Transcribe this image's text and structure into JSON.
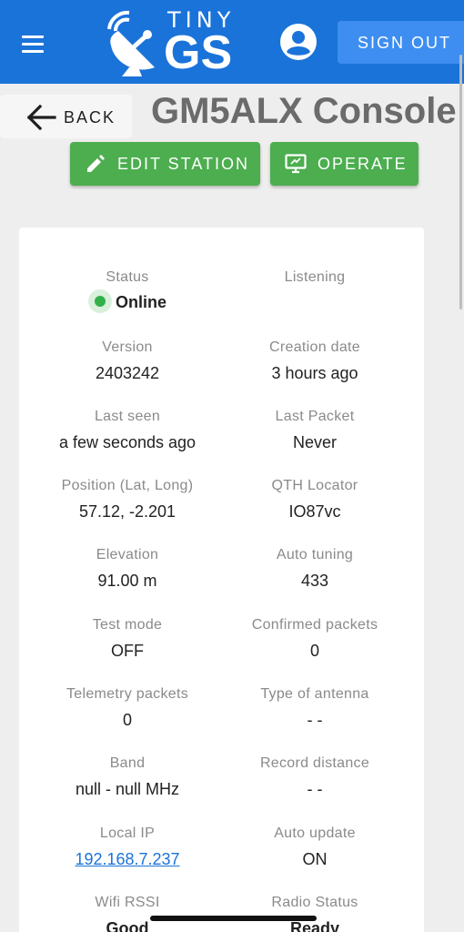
{
  "header": {
    "logo_top": "TINY",
    "logo_main": "GS",
    "signout_label": "SIGN OUT"
  },
  "nav": {
    "back_label": "BACK",
    "page_title": "GM5ALX Console"
  },
  "actions": {
    "edit_label": "EDIT STATION",
    "operate_label": "OPERATE"
  },
  "colors": {
    "appbar": "#1a73d9",
    "primary_button": "#4cae4f",
    "online": "#3aa548"
  },
  "fields": [
    {
      "label": "Status",
      "value": "Online"
    },
    {
      "label": "Listening",
      "value": ""
    },
    {
      "label": "Version",
      "value": "2403242"
    },
    {
      "label": "Creation date",
      "value": "3 hours ago"
    },
    {
      "label": "Last seen",
      "value": "a few seconds ago"
    },
    {
      "label": "Last Packet",
      "value": "Never"
    },
    {
      "label": "Position (Lat, Long)",
      "value": "57.12, -2.201"
    },
    {
      "label": "QTH Locator",
      "value": "IO87vc"
    },
    {
      "label": "Elevation",
      "value": "91.00 m"
    },
    {
      "label": "Auto tuning",
      "value": "433"
    },
    {
      "label": "Test mode",
      "value": "OFF"
    },
    {
      "label": "Confirmed packets",
      "value": "0"
    },
    {
      "label": "Telemetry packets",
      "value": "0"
    },
    {
      "label": "Type of antenna",
      "value": "- -"
    },
    {
      "label": "Band",
      "value": "null - null MHz"
    },
    {
      "label": "Record distance",
      "value": "- -"
    },
    {
      "label": "Local IP",
      "value": "192.168.7.237"
    },
    {
      "label": "Auto update",
      "value": "ON"
    },
    {
      "label": "Wifi RSSI",
      "value": "Good"
    },
    {
      "label": "Radio Status",
      "value": "Ready"
    }
  ]
}
